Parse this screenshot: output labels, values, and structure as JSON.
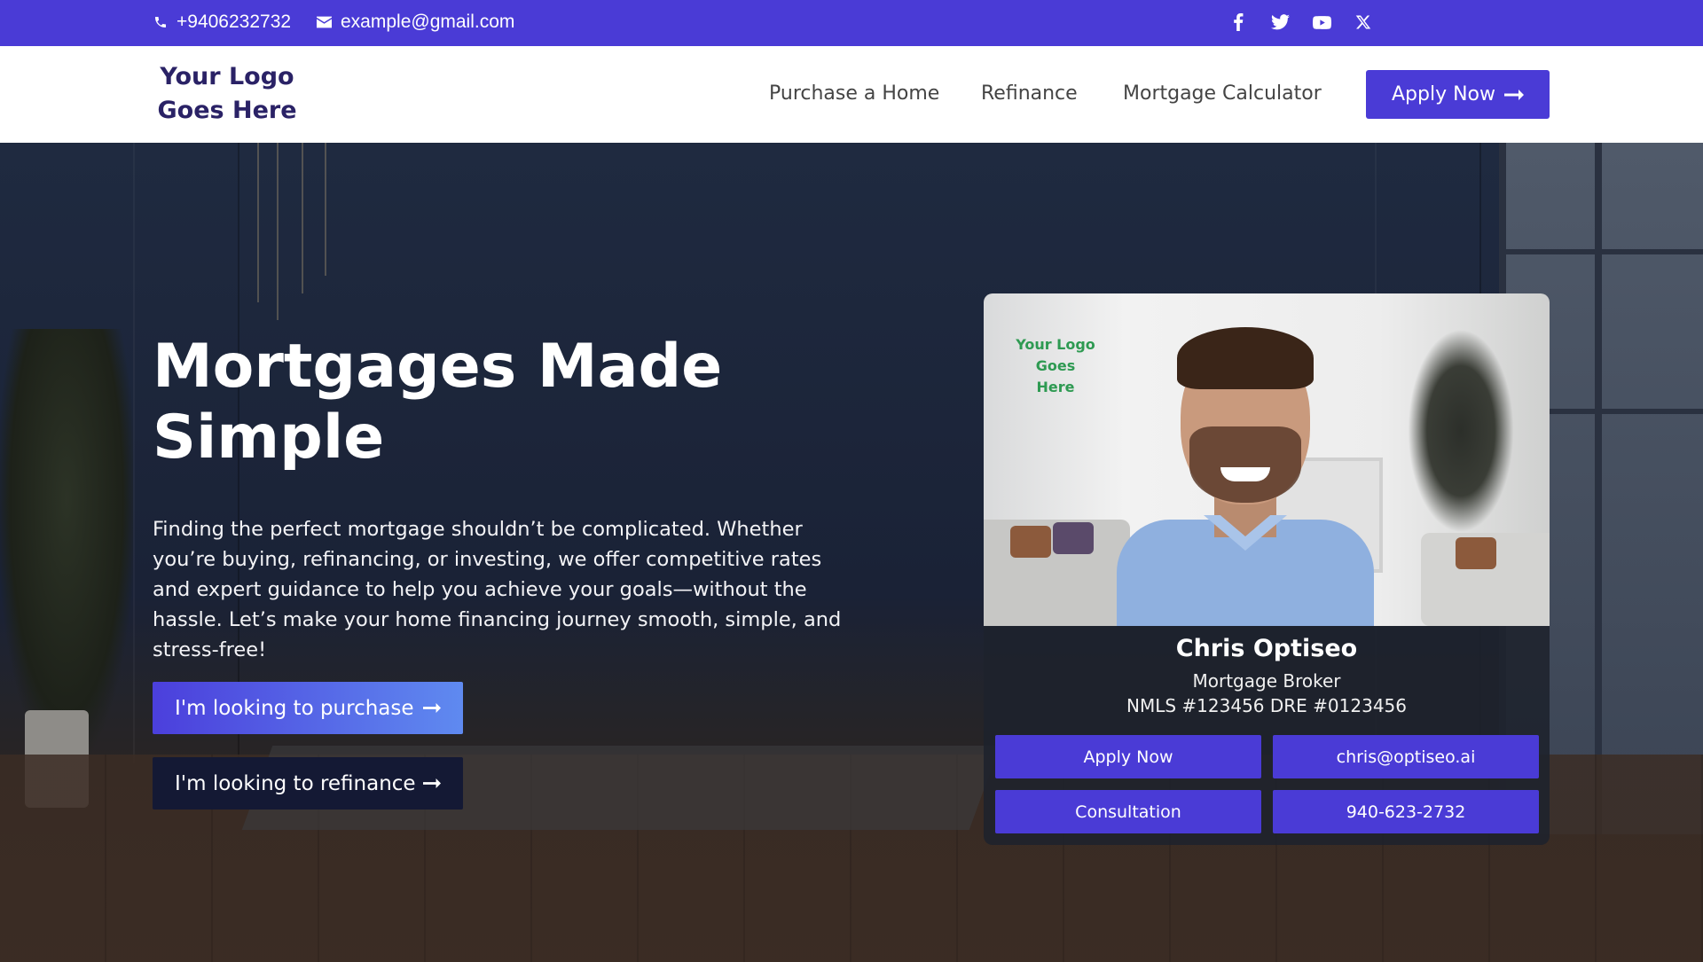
{
  "topbar": {
    "phone": "+9406232732",
    "email": "example@gmail.com",
    "social": [
      "facebook-icon",
      "twitter-icon",
      "youtube-icon",
      "x-icon"
    ]
  },
  "header": {
    "logo_line1": "Your Logo",
    "logo_line2": "Goes Here",
    "nav": [
      "Purchase a Home",
      "Refinance",
      "Mortgage Calculator"
    ],
    "apply_label": "Apply Now"
  },
  "hero": {
    "title": "Mortgages Made Simple",
    "text": "Finding the perfect mortgage shouldn’t be complicated. Whether you’re buying, refinancing, or investing, we offer competitive rates and expert guidance to help you achieve your goals—without the hassle. Let’s make your home financing journey smooth, simple, and stress-free!",
    "btn_purchase": "I'm looking to purchase",
    "btn_refinance": "I'm looking to refinance"
  },
  "card": {
    "logo_line1": "Your Logo",
    "logo_line2": "Goes Here",
    "name": "Chris Optiseo",
    "role": "Mortgage Broker",
    "license": "NMLS #123456 DRE #0123456",
    "buttons": [
      "Apply Now",
      "chris@optiseo.ai",
      "Consultation",
      "940-623-2732"
    ]
  },
  "colors": {
    "brand": "#4a3bd6",
    "logo_text": "#2a2266",
    "card_logo": "#2e9a52"
  }
}
